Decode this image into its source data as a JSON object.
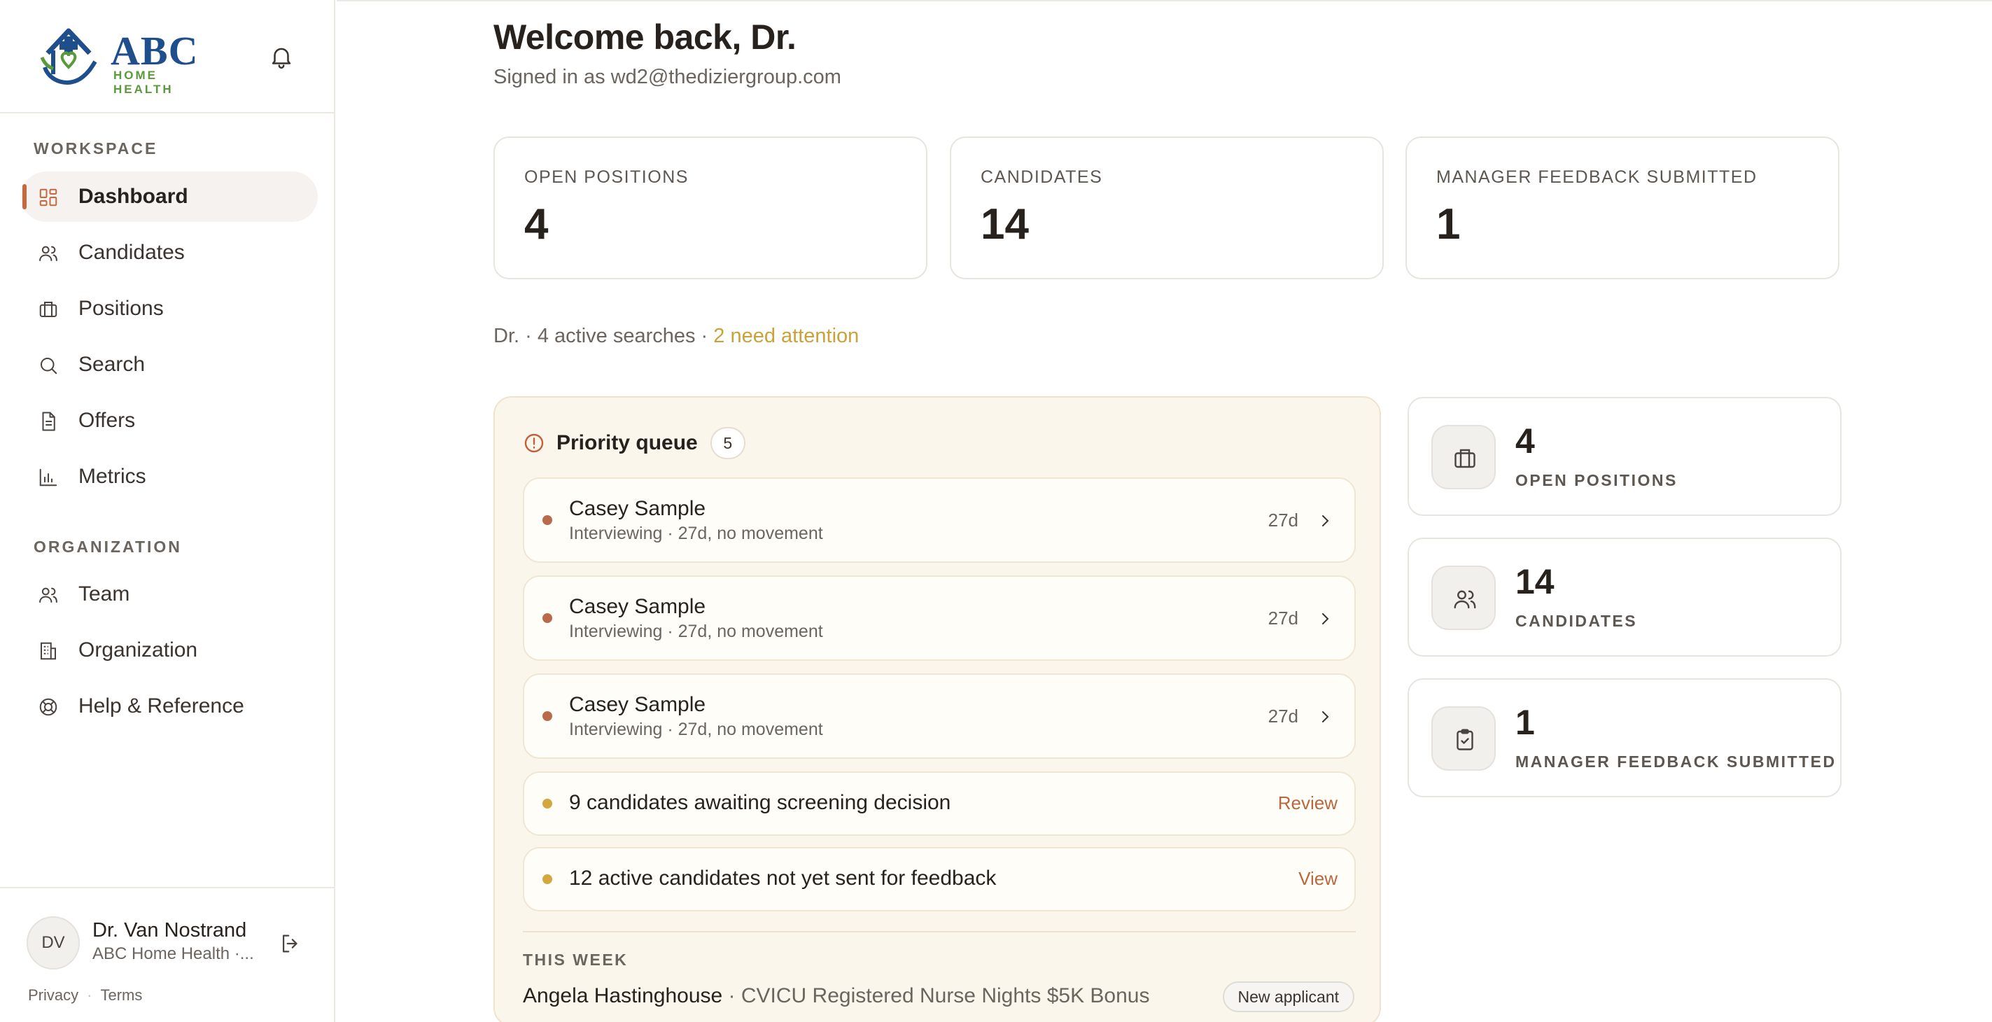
{
  "brand": {
    "logo_text": "ABC",
    "logo_subtext": "HOME HEALTH",
    "logo_color": "#1f4e8c",
    "logo_accent": "#5a9a3a"
  },
  "sidebar": {
    "workspace_label": "WORKSPACE",
    "workspace_items": [
      {
        "label": "Dashboard",
        "icon": "dashboard-icon",
        "active": true
      },
      {
        "label": "Candidates",
        "icon": "users-icon"
      },
      {
        "label": "Positions",
        "icon": "briefcase-icon"
      },
      {
        "label": "Search",
        "icon": "search-icon"
      },
      {
        "label": "Offers",
        "icon": "document-icon"
      },
      {
        "label": "Metrics",
        "icon": "bar-chart-icon"
      }
    ],
    "organization_label": "ORGANIZATION",
    "organization_items": [
      {
        "label": "Team",
        "icon": "team-icon"
      },
      {
        "label": "Organization",
        "icon": "building-icon"
      },
      {
        "label": "Help & Reference",
        "icon": "lifebuoy-icon"
      }
    ]
  },
  "user": {
    "initials": "DV",
    "name": "Dr. Van Nostrand",
    "org": "ABC Home Health ·...",
    "privacy": "Privacy",
    "terms": "Terms"
  },
  "header": {
    "welcome": "Welcome back, Dr.",
    "signed_in": "Signed in as wd2@thediziergroup.com"
  },
  "stats": [
    {
      "label": "OPEN POSITIONS",
      "value": "4"
    },
    {
      "label": "CANDIDATES",
      "value": "14"
    },
    {
      "label": "MANAGER FEEDBACK SUBMITTED",
      "value": "1"
    }
  ],
  "summary": {
    "text": "Dr. · 4 active searches · ",
    "attention": "2 need attention",
    "attention_color": "#c9a23a"
  },
  "priority_queue": {
    "title": "Priority queue",
    "count": "5",
    "candidate_rows": [
      {
        "name": "Casey Sample",
        "sub": "Interviewing · 27d, no movement",
        "age": "27d"
      },
      {
        "name": "Casey Sample",
        "sub": "Interviewing · 27d, no movement",
        "age": "27d"
      },
      {
        "name": "Casey Sample",
        "sub": "Interviewing · 27d, no movement",
        "age": "27d"
      }
    ],
    "task_rows": [
      {
        "text": "9 candidates awaiting screening decision",
        "action": "Review"
      },
      {
        "text": "12 active candidates not yet sent for feedback",
        "action": "View"
      }
    ],
    "this_week_label": "THIS WEEK",
    "this_week": {
      "name": "Angela Hastinghouse",
      "detail": " · CVICU Registered Nurse Nights $5K Bonus",
      "badge": "New applicant"
    }
  },
  "mini_cards": [
    {
      "value": "4",
      "label": "OPEN POSITIONS",
      "icon": "briefcase-icon"
    },
    {
      "value": "14",
      "label": "CANDIDATES",
      "icon": "users-icon"
    },
    {
      "value": "1",
      "label": "MANAGER FEEDBACK SUBMITTED",
      "icon": "clipboard-check-icon"
    }
  ],
  "colors": {
    "accent": "#c46a3e",
    "attention": "#c9a23a",
    "queue_bg": "#fbf6ec"
  }
}
